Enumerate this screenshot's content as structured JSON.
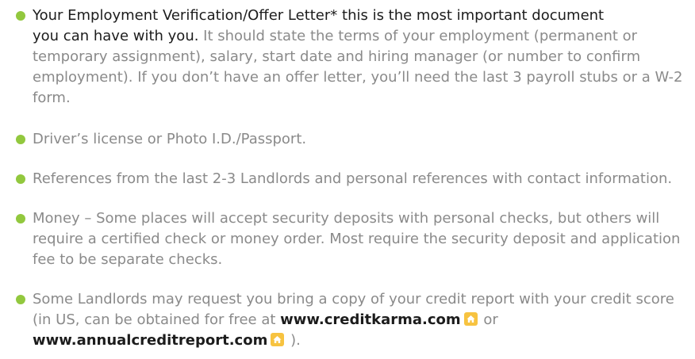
{
  "items": [
    {
      "lead_line1": "Your Employment Verification/Offer Letter* this is the most important document",
      "lead_line2": "you can have with you.",
      "body": " It should state the terms of your employment (permanent or temporary assignment), salary, start date and hiring manager (or number to confirm employment). If you don’t have an offer letter, you’ll need the last 3 payroll stubs or a W-2 form."
    },
    {
      "text": "Driver’s license or Photo I.D./Passport."
    },
    {
      "text": "References from the last 2-3 Landlords and personal references with contact information."
    },
    {
      "text": "Money – Some places will accept security deposits with personal checks, but others will require a certified check or money order. Most require the security deposit and application fee to be separate checks."
    },
    {
      "text_before": "Some Landlords may request you bring a copy of your credit report with your credit score (in US, can be obtained for free at ",
      "link1": "www.creditkarma.com",
      "between": " or ",
      "link2": "www.annualcreditreport.com",
      "after": " )."
    }
  ],
  "colors": {
    "bullet": "#92c83e",
    "body_text": "#8a8a8a",
    "emphasis_text": "#1c1c1c",
    "icon_bg": "#f7c340"
  },
  "icons": {
    "bullet": "bullet-dot-icon",
    "external": "home-icon"
  }
}
